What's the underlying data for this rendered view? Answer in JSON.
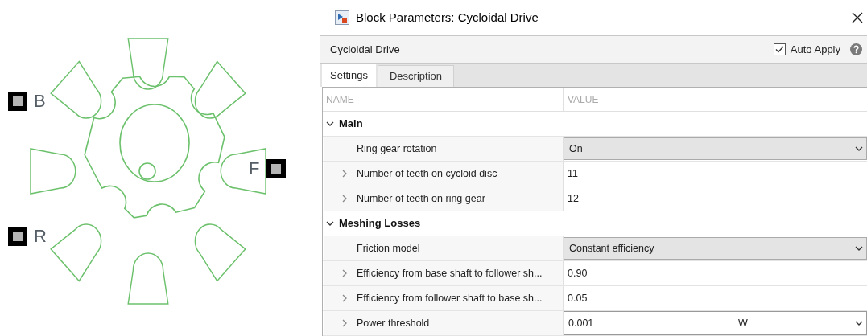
{
  "block": {
    "ports": [
      {
        "label": "B"
      },
      {
        "label": "R"
      },
      {
        "label": "F"
      }
    ]
  },
  "dialog": {
    "title": "Block Parameters: Cycloidal Drive",
    "block_name": "Cycloidal Drive",
    "auto_apply": {
      "label": "Auto Apply",
      "checked": true
    }
  },
  "tabs": [
    {
      "label": "Settings",
      "selected": true
    },
    {
      "label": "Description",
      "selected": false
    }
  ],
  "table": {
    "columns": [
      "NAME",
      "VALUE"
    ],
    "sections": [
      {
        "title": "Main",
        "expanded": true,
        "rows": [
          {
            "kind": "dropdown",
            "name": "Ring gear rotation",
            "value": "On"
          },
          {
            "kind": "field",
            "expandable": true,
            "name": "Number of teeth on cycloid disc",
            "value": "11"
          },
          {
            "kind": "field",
            "expandable": true,
            "name": "Number of teeth on ring gear",
            "value": "12"
          }
        ]
      },
      {
        "title": "Meshing Losses",
        "expanded": true,
        "rows": [
          {
            "kind": "dropdown",
            "name": "Friction model",
            "value": "Constant efficiency"
          },
          {
            "kind": "field",
            "expandable": true,
            "name": "Efficiency from base shaft to follower sh...",
            "value": "0.90"
          },
          {
            "kind": "field",
            "expandable": true,
            "name": "Efficiency from follower shaft to base sh...",
            "value": "0.05"
          },
          {
            "kind": "field_unit",
            "expandable": true,
            "name": "Power threshold",
            "value": "0.001",
            "unit": "W"
          }
        ]
      }
    ]
  }
}
